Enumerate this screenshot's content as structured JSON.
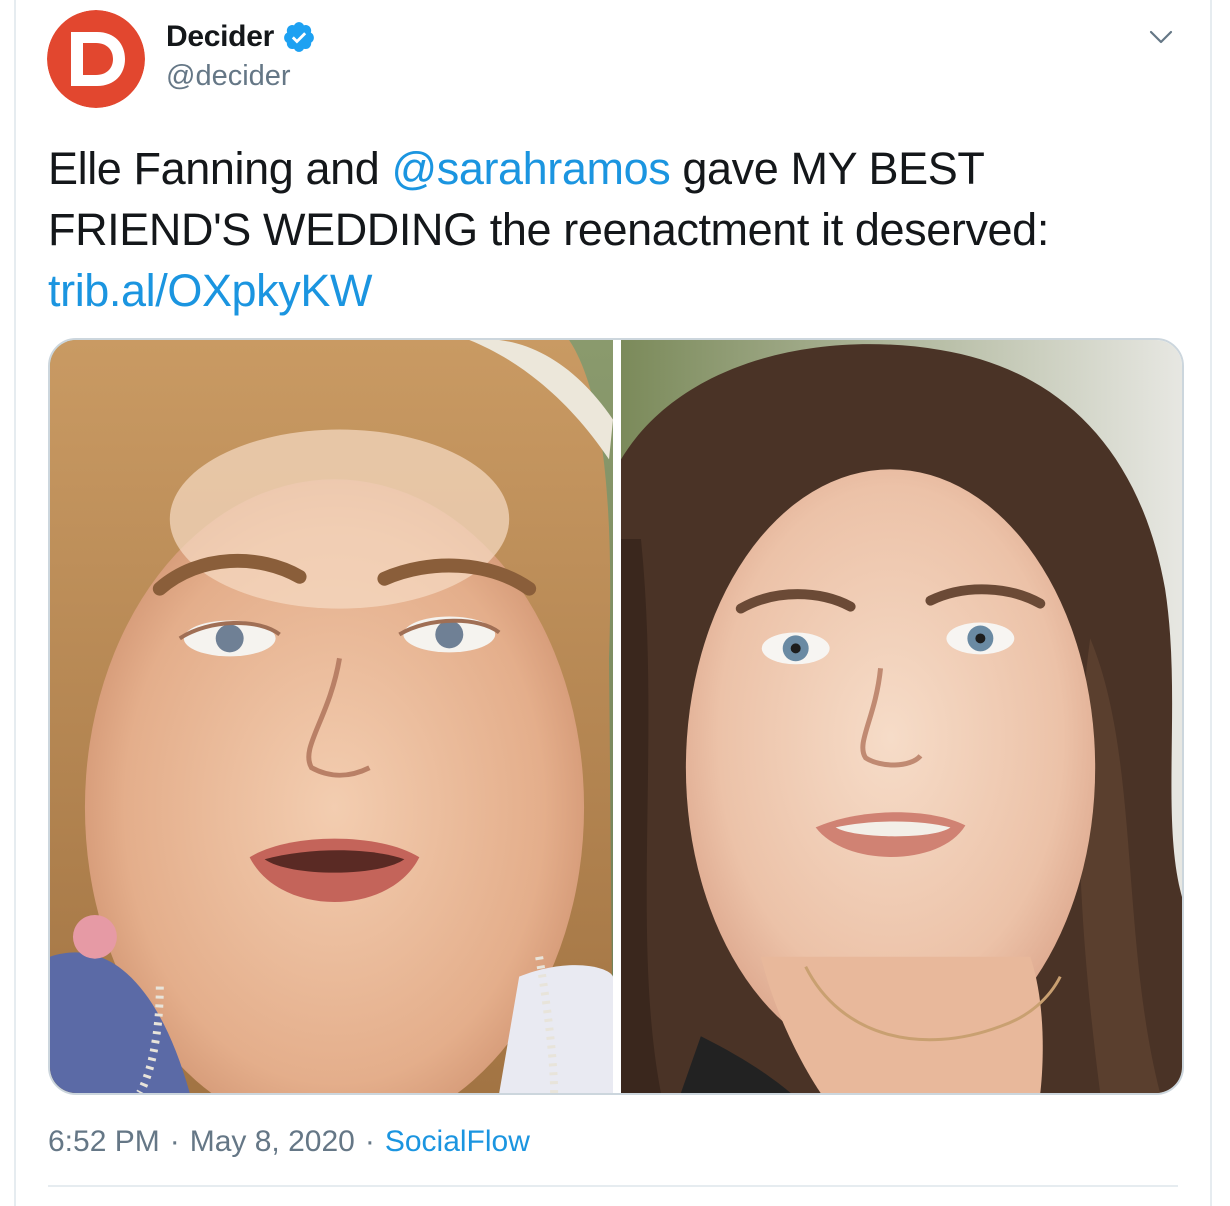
{
  "tweet": {
    "author": {
      "display_name": "Decider",
      "handle": "@decider",
      "verified": true,
      "avatar_icon": "decider-d-logo-icon",
      "brand_color": "#e2472f"
    },
    "text": {
      "prefix": "Elle Fanning and ",
      "mention": "@sarahramos",
      "suffix": " gave MY BEST FRIEND'S WEDDING the reenactment it deserved: ",
      "link": "trib.al/OXpkyKW"
    },
    "media": {
      "left_image": "woman-with-short-blonde-hair-photo",
      "right_image": "woman-with-curly-brown-hair-photo"
    },
    "meta": {
      "time": "6:52 PM",
      "separator": "·",
      "date": "May 8, 2020",
      "source": "SocialFlow"
    },
    "link_color": "#1b95e0",
    "secondary_text_color": "#657786"
  }
}
